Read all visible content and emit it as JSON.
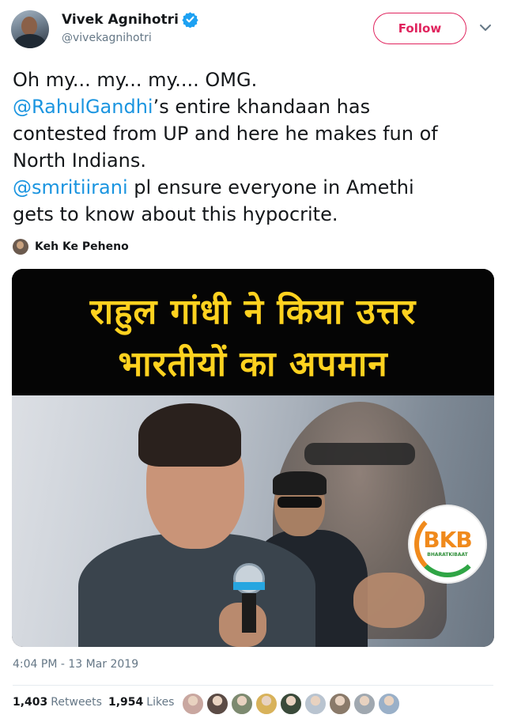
{
  "author": {
    "name": "Vivek Agnihotri",
    "handle": "@vivekagnihotri",
    "verified": true,
    "follow_label": "Follow"
  },
  "tweet": {
    "line1": "Oh my... my... my.... OMG.",
    "mention1": "@RahulGandhi",
    "line2_rest": "’s entire khandaan has",
    "line3": "contested from UP and here he makes fun of",
    "line4": "North Indians.",
    "mention2": "@smritiirani",
    "line5_rest": " pl ensure everyone in Amethi",
    "line6": "gets to know about this hypocrite."
  },
  "card": {
    "author": "Keh Ke Peheno"
  },
  "media": {
    "banner_line1": "राहुल गांधी ने किया उत्तर",
    "banner_line2": "भारतीयों का अपमान",
    "logo_text": "BKB",
    "logo_sub": "BHARATKIBAAT"
  },
  "meta": {
    "timestamp": "4:04 PM - 13 Mar 2019",
    "retweets_count": "1,403",
    "retweets_label": "Retweets",
    "likes_count": "1,954",
    "likes_label": "Likes"
  },
  "colors": {
    "accent": "#1b95e0",
    "follow": "#e0245e",
    "banner_text": "#ffd21f"
  },
  "likers": [
    {
      "color": "#c9a7a0"
    },
    {
      "color": "#5b4b45"
    },
    {
      "color": "#7d8a70"
    },
    {
      "color": "#d8b25a"
    },
    {
      "color": "#3a4a3a"
    },
    {
      "color": "#b9c4d0"
    },
    {
      "color": "#8a7a6a"
    },
    {
      "color": "#a0a8b0"
    },
    {
      "color": "#9ab0c8"
    }
  ]
}
